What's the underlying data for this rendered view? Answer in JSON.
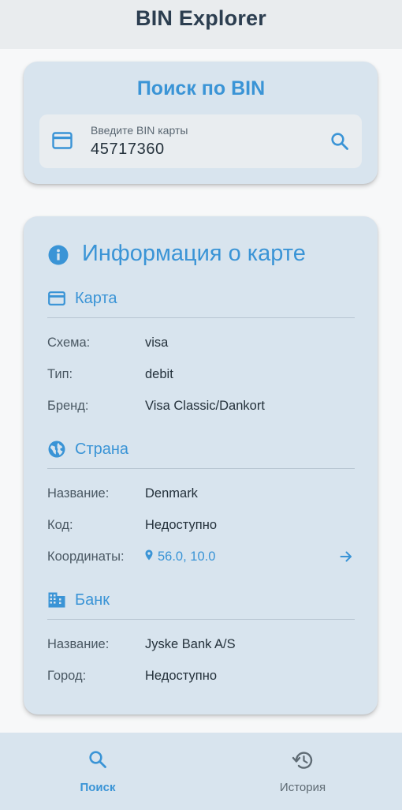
{
  "app": {
    "title": "BIN Explorer"
  },
  "search": {
    "title": "Поиск по BIN",
    "field_label": "Введите BIN карты",
    "field_value": "45717360"
  },
  "info": {
    "title": "Информация о карте",
    "card": {
      "title": "Карта",
      "rows": [
        {
          "label": "Схема:",
          "value": "visa"
        },
        {
          "label": "Тип:",
          "value": "debit"
        },
        {
          "label": "Бренд:",
          "value": "Visa Classic/Dankort"
        }
      ]
    },
    "country": {
      "title": "Страна",
      "rows": [
        {
          "label": "Название:",
          "value": "Denmark"
        },
        {
          "label": "Код:",
          "value": "Недоступно"
        },
        {
          "label": "Координаты:",
          "value": "56.0, 10.0"
        }
      ]
    },
    "bank": {
      "title": "Банк",
      "rows": [
        {
          "label": "Название:",
          "value": "Jyske Bank A/S"
        },
        {
          "label": "Город:",
          "value": "Недоступно"
        }
      ]
    }
  },
  "nav": {
    "items": [
      {
        "label": "Поиск",
        "icon": "search-icon",
        "active": true
      },
      {
        "label": "История",
        "icon": "history-icon",
        "active": false
      }
    ]
  },
  "colors": {
    "accent": "#3a94d6",
    "card_bg": "#d8e4ee",
    "nav_inactive": "#5f6b74"
  }
}
